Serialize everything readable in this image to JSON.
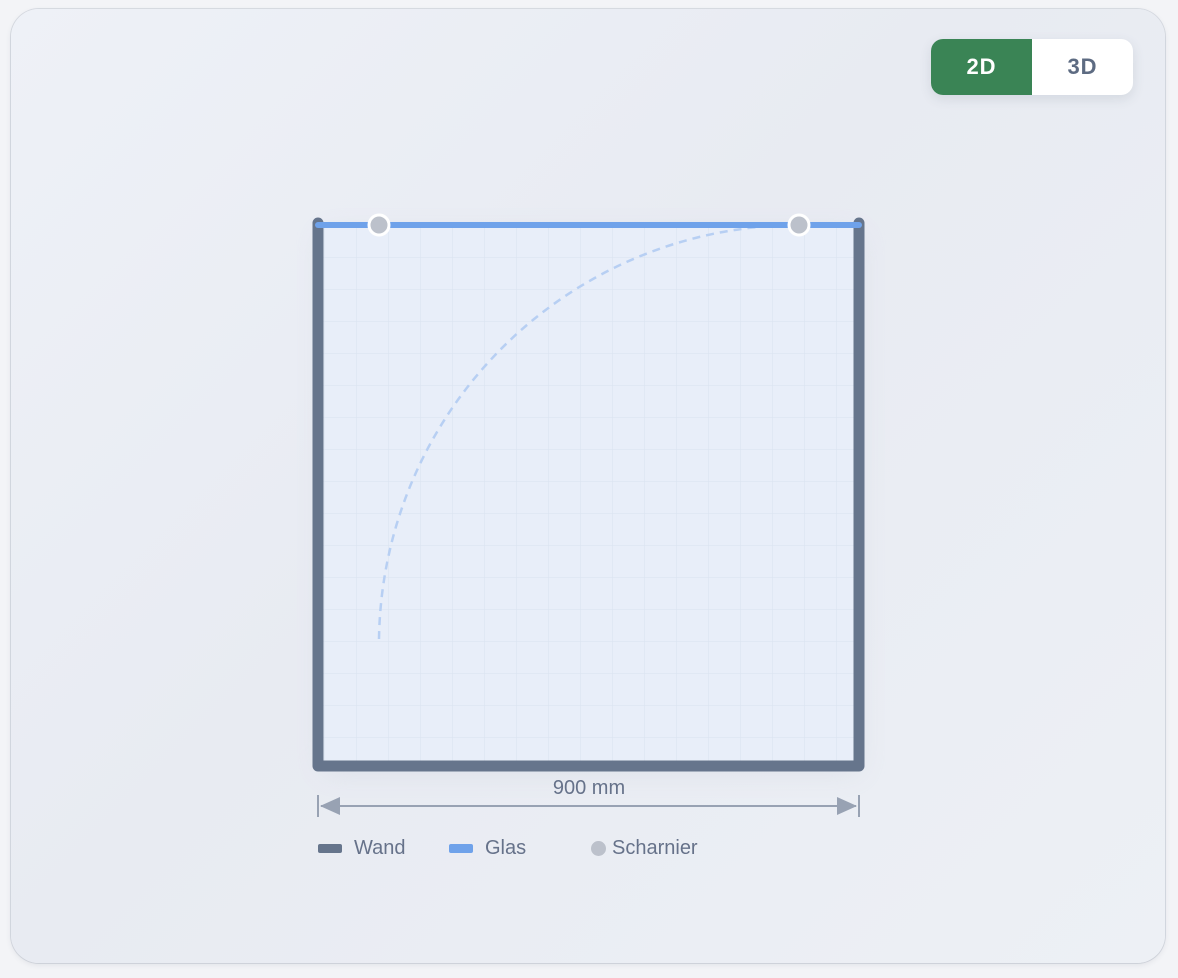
{
  "view_toggle": {
    "options": [
      "2D",
      "3D"
    ],
    "selected": "2D"
  },
  "dimension": {
    "label": "900 mm"
  },
  "legend": {
    "wall_label": "Wand",
    "glass_label": "Glas",
    "hinge_label": "Scharnier"
  },
  "colors": {
    "wall": "#66758c",
    "glass": "#6fa2ea",
    "hinge": "#bcc1cb",
    "active_toggle": "#3a8455",
    "floor": "#e8eef9",
    "swing_arc": "#b7cff3"
  },
  "icons": {
    "hinge": "hinge-dot-icon",
    "dimension_arrow": "dimension-arrow-icon"
  }
}
